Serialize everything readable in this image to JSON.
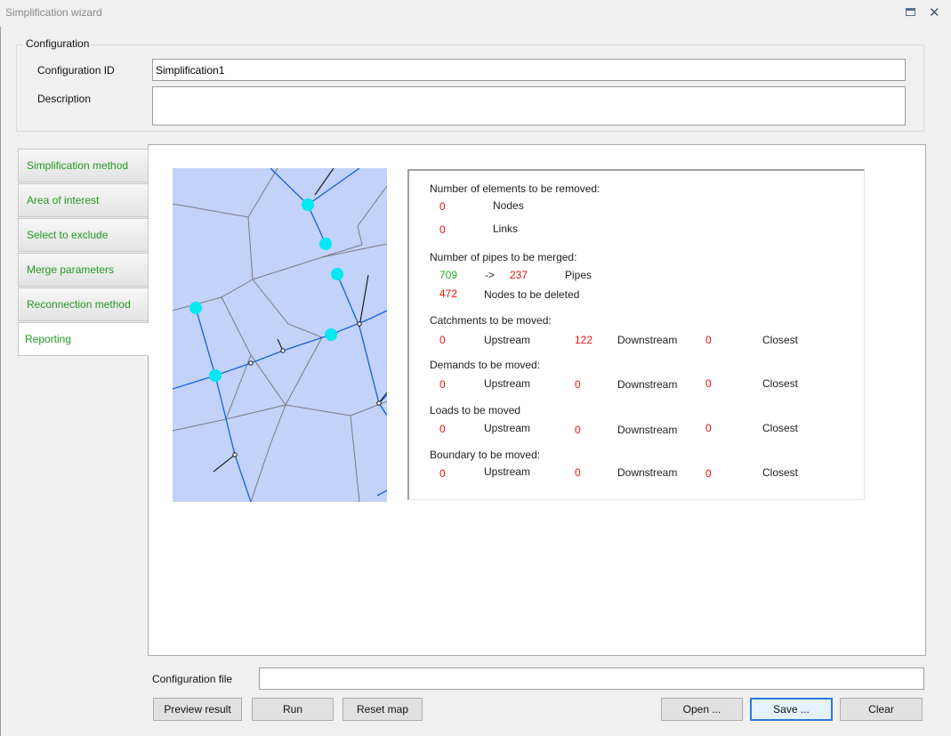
{
  "window": {
    "title": "Simplification wizard",
    "controls": {
      "restore_icon": "restore-icon",
      "close_glyph": "✕"
    }
  },
  "configuration": {
    "group_label": "Configuration",
    "id_label": "Configuration ID",
    "id_value": "Simplification1",
    "description_label": "Description",
    "description_value": ""
  },
  "tabs": [
    {
      "label": "Simplification method",
      "active": false
    },
    {
      "label": "Area of interest",
      "active": false
    },
    {
      "label": "Select to exclude",
      "active": false
    },
    {
      "label": "Merge parameters",
      "active": false
    },
    {
      "label": "Reconnection method",
      "active": false
    },
    {
      "label": "Reporting",
      "active": true
    }
  ],
  "report": {
    "elements_removed": {
      "heading": "Number of elements to be removed:",
      "nodes_value": "0",
      "nodes_label": "Nodes",
      "links_value": "0",
      "links_label": "Links"
    },
    "pipes_merged": {
      "heading": "Number of pipes to be merged:",
      "from_value": "709",
      "arrow": "->",
      "to_value": "237",
      "pipes_label": "Pipes",
      "deleted_value": "472",
      "deleted_label": "Nodes to be deleted"
    },
    "moved_sections": [
      {
        "heading": "Catchments to be moved:",
        "upstream": "0",
        "downstream": "122",
        "closest": "0"
      },
      {
        "heading": "Demands to be moved:",
        "upstream": "0",
        "downstream": "0",
        "closest": "0"
      },
      {
        "heading": "Loads to be moved",
        "upstream": "0",
        "downstream": "0",
        "closest": "0"
      },
      {
        "heading": "Boundary to be moved:",
        "upstream": "0",
        "downstream": "0",
        "closest": "0"
      }
    ],
    "upstream_label": "Upstream",
    "downstream_label": "Downstream",
    "closest_label": "Closest"
  },
  "footer": {
    "config_file_label": "Configuration file",
    "config_file_value": "",
    "buttons": {
      "preview": "Preview result",
      "run": "Run",
      "reset_map": "Reset map",
      "open": "Open ...",
      "save": "Save ...",
      "clear": "Clear"
    }
  },
  "colors": {
    "tab_text": "#229922",
    "value_red": "#ee1111",
    "value_green": "#22aa22",
    "map_background": "#c2d2f9",
    "pipe": "#1463d6",
    "node_highlight": "#00e8f0"
  }
}
